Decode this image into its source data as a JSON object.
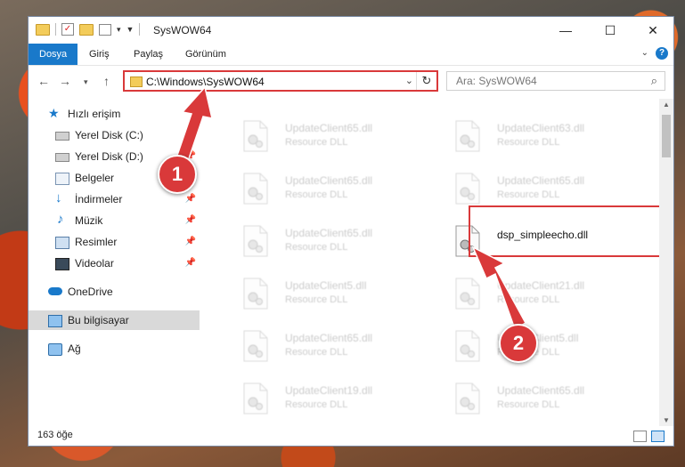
{
  "window": {
    "title": "SysWOW64",
    "controls": {
      "minimize": "—",
      "maximize": "☐",
      "close": "✕"
    }
  },
  "ribbon": {
    "tabs": [
      "Dosya",
      "Giriş",
      "Paylaş",
      "Görünüm"
    ],
    "help": "?"
  },
  "nav": {
    "address": "C:\\Windows\\SysWOW64",
    "search_placeholder": "Ara: SysWOW64"
  },
  "sidebar": {
    "items": [
      {
        "label": "Hızlı erişim",
        "icon": "star-icon",
        "color": "#1979ca"
      },
      {
        "label": "Yerel Disk (C:)",
        "icon": "drive-icon",
        "pinned": true
      },
      {
        "label": "Yerel Disk (D:)",
        "icon": "drive-icon",
        "pinned": true
      },
      {
        "label": "Belgeler",
        "icon": "documents-icon",
        "pinned": true
      },
      {
        "label": "İndirmeler",
        "icon": "download-icon",
        "pinned": true
      },
      {
        "label": "Müzik",
        "icon": "music-icon",
        "pinned": true
      },
      {
        "label": "Resimler",
        "icon": "pictures-icon",
        "pinned": true
      },
      {
        "label": "Videolar",
        "icon": "videos-icon",
        "pinned": true
      },
      {
        "label": "OneDrive",
        "icon": "cloud-icon"
      },
      {
        "label": "Bu bilgisayar",
        "icon": "computer-icon",
        "selected": true
      },
      {
        "label": "Ağ",
        "icon": "network-icon"
      }
    ]
  },
  "files": [
    {
      "name": "UpdateClient65.dll",
      "type": "Resource DLL"
    },
    {
      "name": "UpdateClient63.dll",
      "type": "Resource DLL"
    },
    {
      "name": "UpdateClient65.dll",
      "type": "Resource DLL"
    },
    {
      "name": "UpdateClient65.dll",
      "type": "Resource DLL"
    },
    {
      "name": "UpdateClient65.dll",
      "type": "Resource DLL"
    },
    {
      "name": "dsp_simpleecho.dll",
      "type": "",
      "highlighted": true
    },
    {
      "name": "UpdateClient5.dll",
      "type": "Resource DLL"
    },
    {
      "name": "UpdateClient21.dll",
      "type": "Resource DLL"
    },
    {
      "name": "UpdateClient65.dll",
      "type": "Resource DLL"
    },
    {
      "name": "UpdateClient5.dll",
      "type": "Resource DLL"
    },
    {
      "name": "UpdateClient19.dll",
      "type": "Resource DLL"
    },
    {
      "name": "UpdateClient65.dll",
      "type": "Resource DLL"
    }
  ],
  "status": {
    "count": "163 öğe"
  },
  "annotations": [
    {
      "label": "1"
    },
    {
      "label": "2"
    }
  ],
  "colors": {
    "accent": "#1979ca",
    "highlight": "#d9393a"
  }
}
